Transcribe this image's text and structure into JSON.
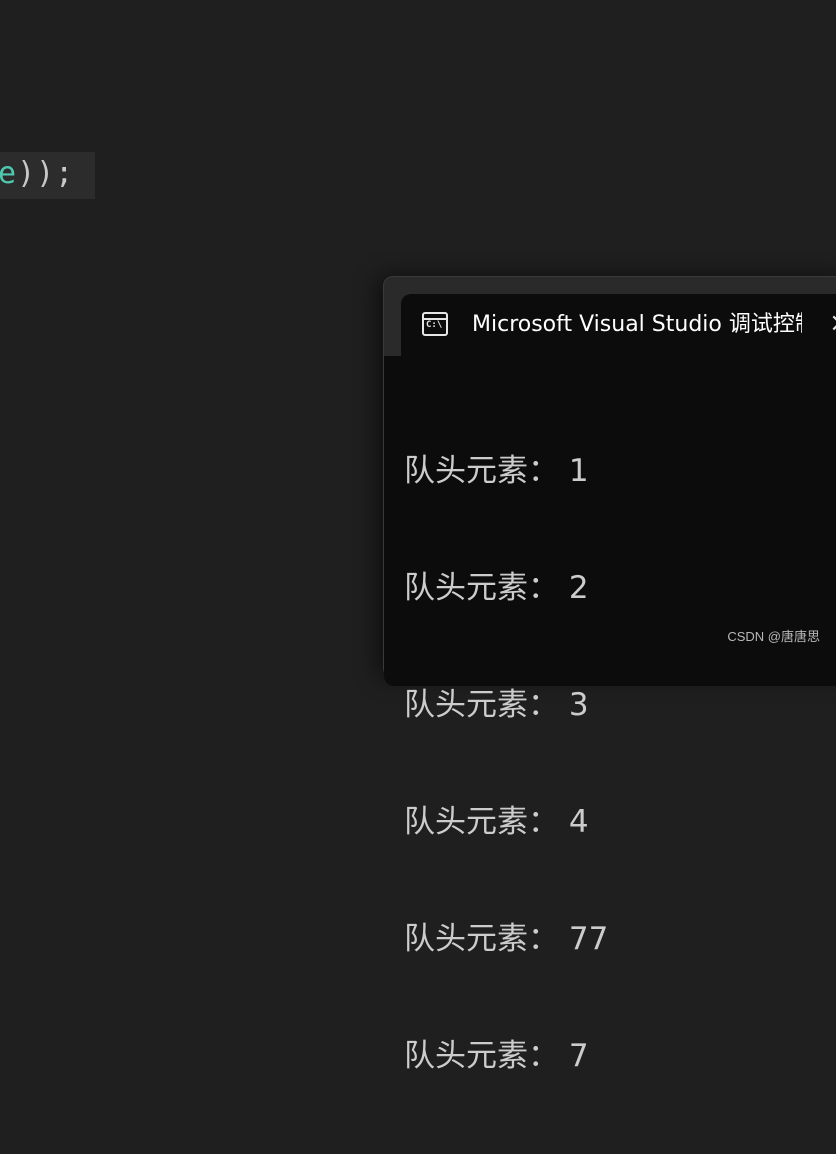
{
  "editor": {
    "code_fragment_ident": "e",
    "code_fragment_rest": "));"
  },
  "console": {
    "title": "Microsoft Visual Studio 调试控制台",
    "icon": "console-icon",
    "icon_text": "C:\\",
    "close": "×",
    "lines": [
      "队头元素： 1",
      "队头元素： 2",
      "队头元素： 3",
      "队头元素： 4",
      "队头元素： 77",
      "队头元素： 7"
    ]
  },
  "watermark": "CSDN @唐唐思"
}
